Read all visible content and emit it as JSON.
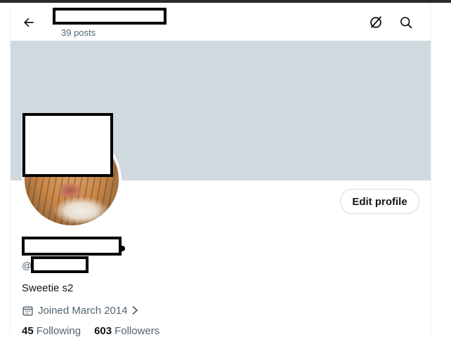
{
  "header": {
    "post_count": "39 posts",
    "icons": {
      "back": "arrow-left-icon",
      "grok": "grok-icon",
      "search": "search-icon"
    }
  },
  "profile": {
    "edit_label": "Edit profile",
    "at_prefix": "@",
    "bio": "Sweetie s2",
    "joined": "Joined March 2014",
    "following_count": "45",
    "following_label": "Following",
    "followers_count": "603",
    "followers_label": "Followers"
  },
  "colors": {
    "banner": "#cfd9de",
    "primary_text": "#0f1419",
    "secondary_text": "#536471",
    "border": "#cfd9de"
  }
}
